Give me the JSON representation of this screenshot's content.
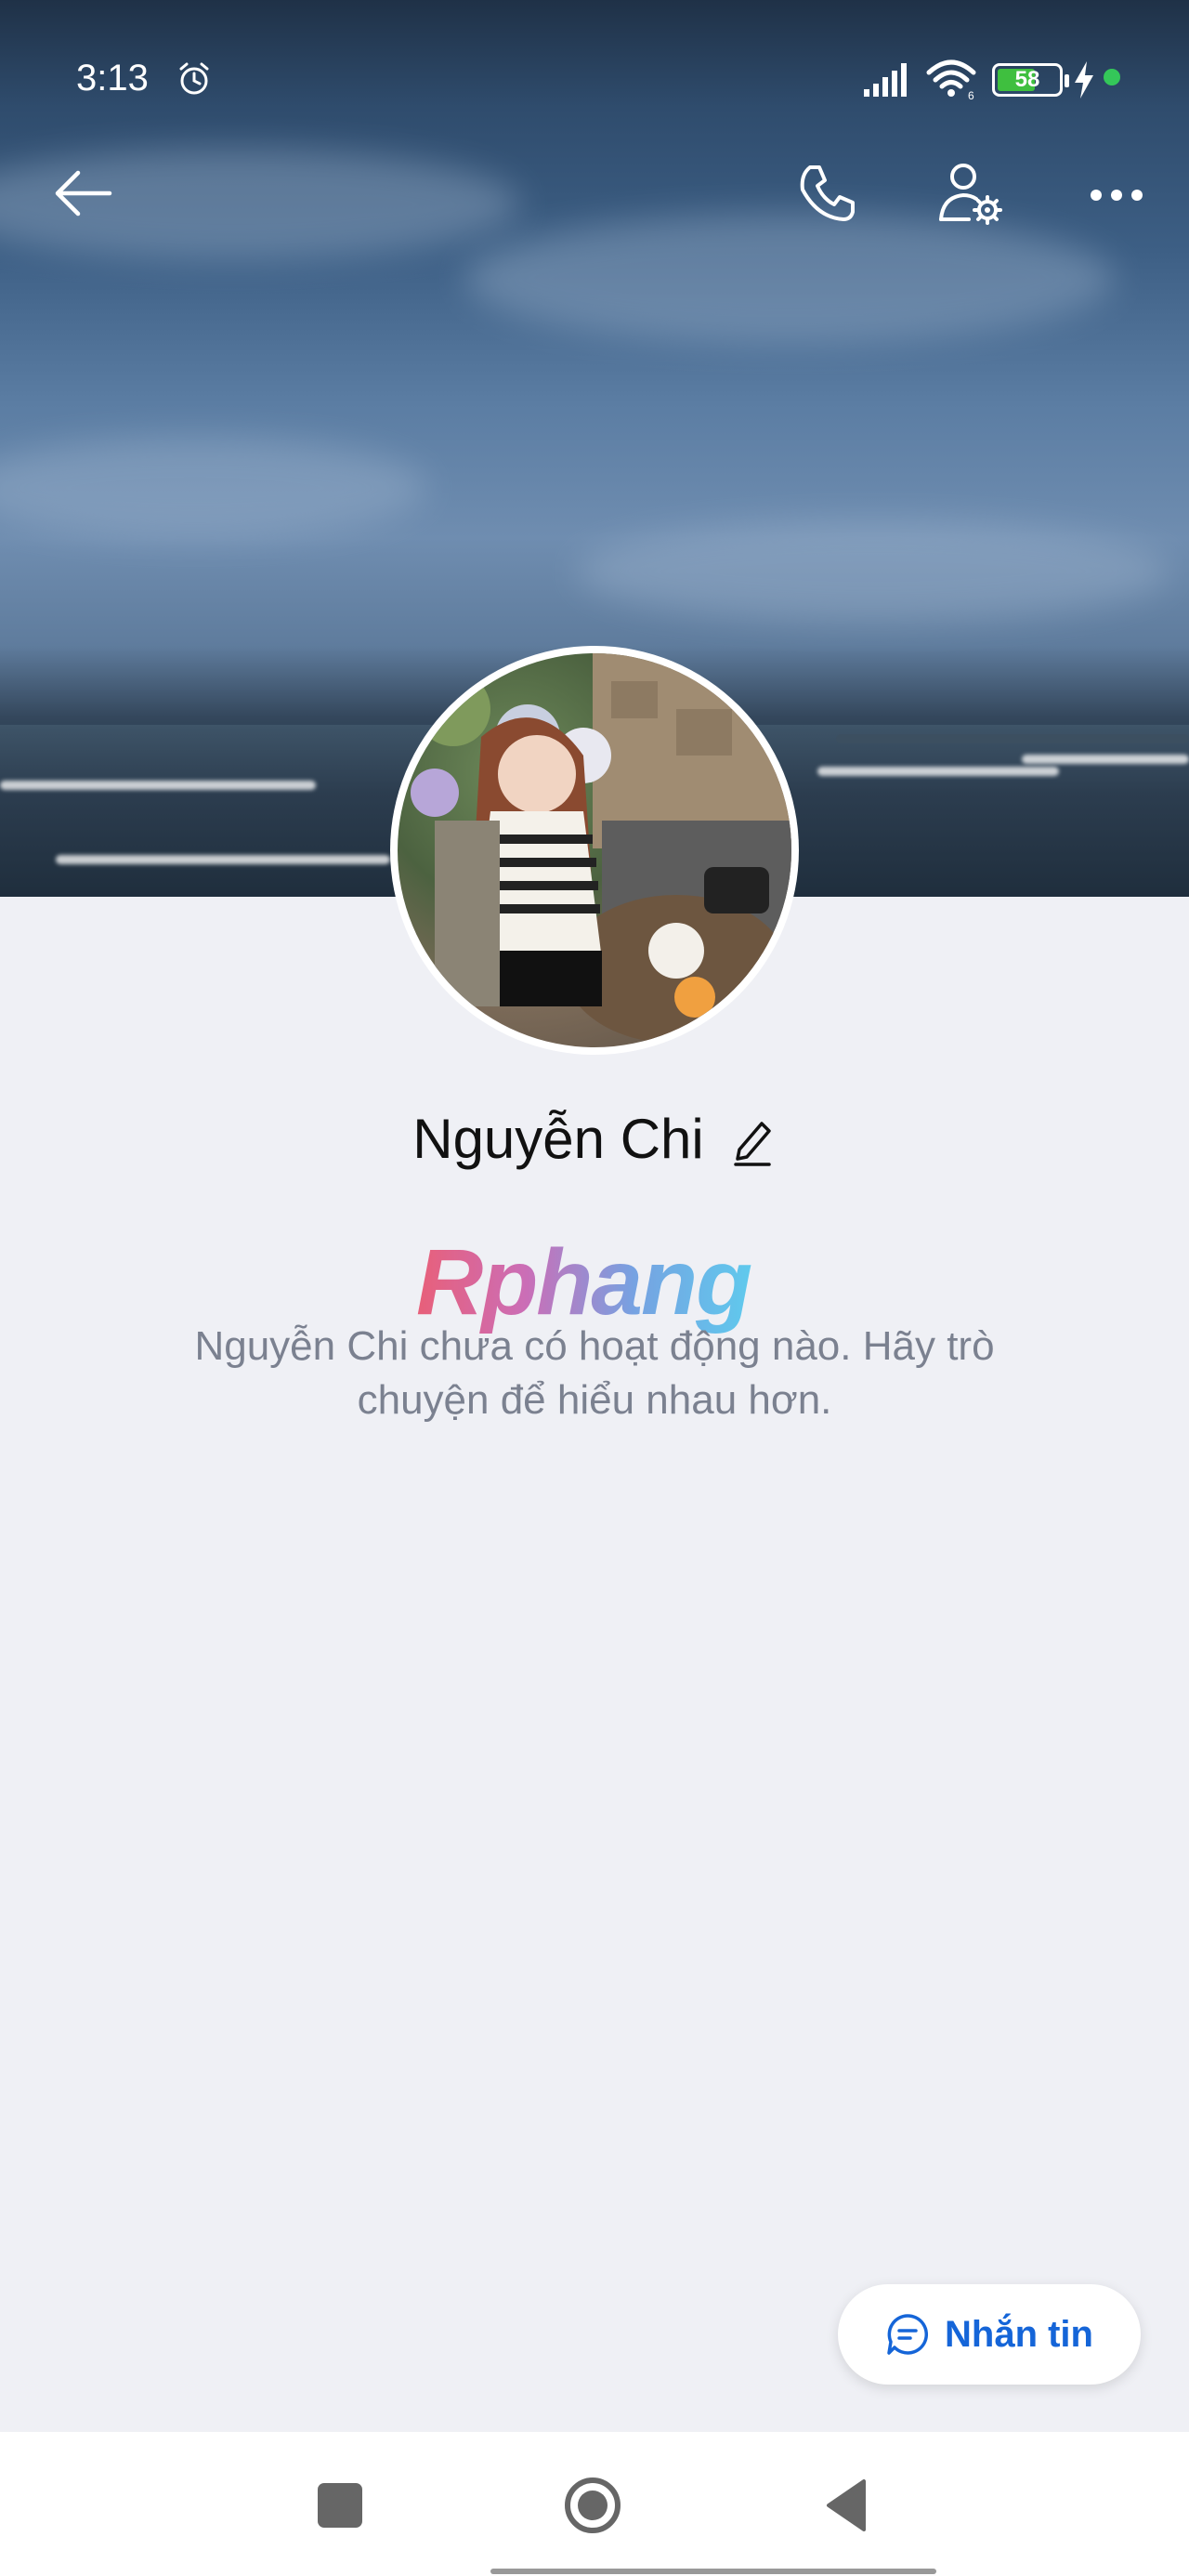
{
  "status_bar": {
    "time": "3:13",
    "battery_level": "58",
    "icons": [
      "alarm-icon",
      "signal-icon",
      "wifi-icon",
      "battery-icon",
      "charging-icon",
      "active-dot"
    ]
  },
  "toolbar": {
    "icons": [
      "back-arrow-icon",
      "phone-icon",
      "user-settings-icon",
      "more-icon"
    ]
  },
  "profile": {
    "name": "Nguyễn Chi",
    "watermark_text": "Rphang",
    "empty_message": "Nguyễn Chi chưa có hoạt động nào. Hãy trò chuyện để hiểu nhau hơn."
  },
  "actions": {
    "message_button_label": "Nhắn tin"
  },
  "navigation": {
    "icons": [
      "recents-square-icon",
      "home-circle-icon",
      "back-triangle-icon"
    ]
  },
  "colors": {
    "accent": "#1565d8",
    "background": "#eff0f5",
    "battery_fill": "#3fbf3f",
    "active_dot": "#34c759"
  }
}
